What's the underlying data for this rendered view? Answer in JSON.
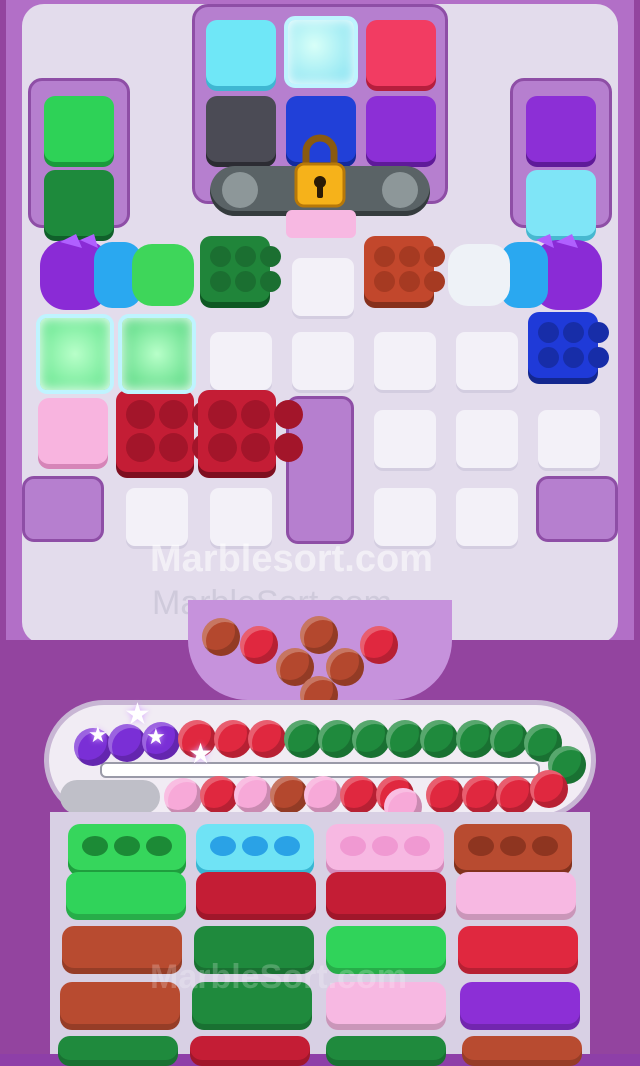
{
  "watermarks": {
    "primary": "Marblesort.com",
    "secondary": "MarbleSort.com",
    "tray": "MarbleSort.com"
  },
  "colors": {
    "frame": "#93449f",
    "board": "#e3dcec",
    "wall": "#b67fcf",
    "pink": "#f8b8de",
    "red": "#d8263f",
    "green": "#1d8a3b",
    "brown": "#b84b30",
    "purple": "#8c2fd0",
    "blue": "#2447c7",
    "cyan": "#7fe3f5",
    "lime": "#38d65a"
  },
  "board": {
    "lock_icon": "padlock-icon",
    "ice_icon": "ice-block-icon",
    "cannon_icon": "color-cannon-icon"
  },
  "queue": {
    "count": 0
  },
  "tray": {
    "columns": [
      {
        "top": "green",
        "stack": [
          "green",
          "brown",
          "brown",
          "green"
        ]
      },
      {
        "top": "cyan",
        "stack": [
          "red",
          "green",
          "green",
          "red"
        ]
      },
      {
        "top": "pink",
        "stack": [
          "red",
          "lime",
          "pink",
          "green"
        ]
      },
      {
        "top": "brown",
        "stack": [
          "pink",
          "red",
          "purple",
          "brown"
        ]
      }
    ]
  }
}
